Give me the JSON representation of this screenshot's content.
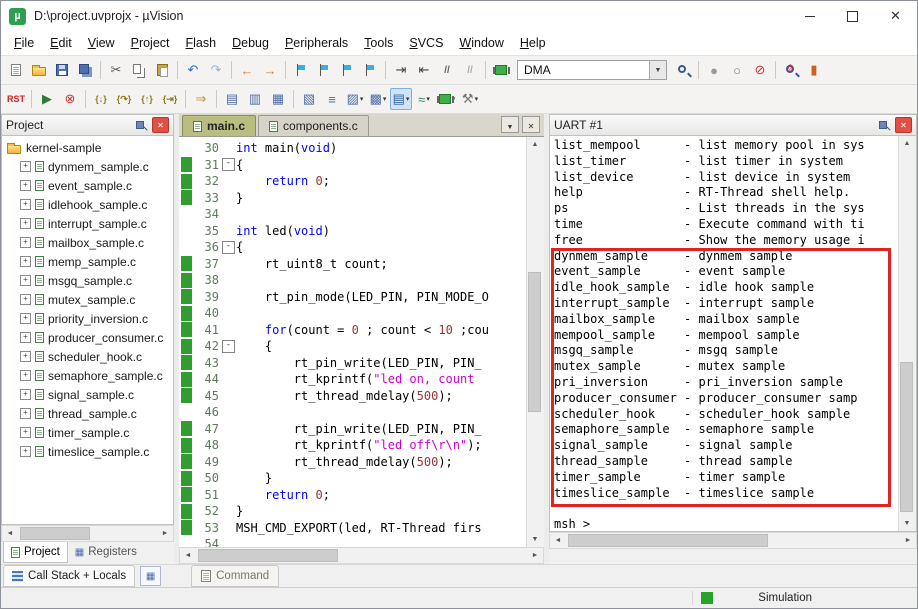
{
  "window": {
    "title": "D:\\project.uvprojx - µVision"
  },
  "menu": [
    "File",
    "Edit",
    "View",
    "Project",
    "Flash",
    "Debug",
    "Peripherals",
    "Tools",
    "SVCS",
    "Window",
    "Help"
  ],
  "toolbar1": {
    "target": "DMA",
    "items": [
      {
        "n": "new-file",
        "cls": "page"
      },
      {
        "n": "open-file",
        "cls": "folder"
      },
      {
        "n": "save",
        "cls": "floppy"
      },
      {
        "n": "save-all",
        "cls": "floppy2"
      },
      {
        "sep": true
      },
      {
        "n": "cut",
        "g": "✂",
        "c": "#555555"
      },
      {
        "n": "copy",
        "cls": "copy"
      },
      {
        "n": "paste",
        "cls": "paste"
      },
      {
        "sep": true
      },
      {
        "n": "undo",
        "g": "↶",
        "c": "#2d6cb4"
      },
      {
        "n": "redo",
        "g": "↷",
        "c": "#9ab0cc"
      },
      {
        "sep": true
      },
      {
        "n": "navigate-back",
        "g": "←",
        "c": "#e07a1f"
      },
      {
        "n": "navigate-forward",
        "g": "→",
        "c": "#e07a1f"
      },
      {
        "sep": true
      },
      {
        "n": "toggle-bookmark",
        "cls": "flag"
      },
      {
        "n": "prev-bookmark",
        "cls": "flag"
      },
      {
        "n": "next-bookmark",
        "cls": "flag"
      },
      {
        "n": "clear-bookmarks",
        "cls": "flag"
      },
      {
        "sep": true
      },
      {
        "n": "indent",
        "g": "⇥",
        "c": "#444444"
      },
      {
        "n": "outdent",
        "g": "⇤",
        "c": "#444444"
      },
      {
        "n": "comment",
        "g": "//",
        "c": "#666666"
      },
      {
        "n": "uncomment",
        "g": "//",
        "c": "#aaaaaa"
      },
      {
        "sep": true
      },
      {
        "n": "flash-download",
        "cls": "chip"
      },
      {
        "combo": true
      },
      {
        "n": "find-in-files",
        "cls": "magnifier"
      },
      {
        "sep": true
      },
      {
        "n": "insert-breakpoint",
        "g": "●",
        "c": "#9a9a9a"
      },
      {
        "n": "enable-breakpoint",
        "g": "○",
        "c": "#777777"
      },
      {
        "n": "kill-breakpoints",
        "g": "⊘",
        "c": "#cc3333"
      },
      {
        "sep": true
      },
      {
        "n": "help-search",
        "cls": "magnifier2"
      },
      {
        "n": "infocenter",
        "g": "▮",
        "c": "#d06020"
      }
    ]
  },
  "toolbar2": {
    "items": [
      {
        "n": "reset-cpu",
        "g": "RST",
        "c": "#cc2222"
      },
      {
        "sep": true
      },
      {
        "n": "run",
        "g": "▶",
        "c": "#2f7d32"
      },
      {
        "n": "stop",
        "g": "⊗",
        "c": "#cc3333"
      },
      {
        "sep": true
      },
      {
        "n": "step-into",
        "g": "{↓}",
        "c": "#8a7a1a"
      },
      {
        "n": "step-over",
        "g": "{↷}",
        "c": "#8a7a1a"
      },
      {
        "n": "step-out",
        "g": "{↑}",
        "c": "#8a7a1a"
      },
      {
        "n": "run-to-cursor",
        "g": "{⇥}",
        "c": "#8a7a1a"
      },
      {
        "sep": true
      },
      {
        "n": "show-next-statement",
        "g": "⇒",
        "c": "#d98a1f"
      },
      {
        "sep": true
      },
      {
        "n": "command-window",
        "g": "▤",
        "c": "#4a6da8"
      },
      {
        "n": "disassembly-window",
        "g": "▥",
        "c": "#4a6da8"
      },
      {
        "n": "symbol-window",
        "g": "▦",
        "c": "#4a6da8"
      },
      {
        "sep": true
      },
      {
        "n": "registers-window",
        "g": "▧",
        "c": "#4a6da8"
      },
      {
        "n": "call-stack-window",
        "g": "≡",
        "c": "#4a6da8"
      },
      {
        "n": "watch-window",
        "g": "▨",
        "c": "#4a6da8",
        "caret": true
      },
      {
        "n": "memory-window",
        "g": "▩",
        "c": "#4a6da8",
        "caret": true
      },
      {
        "n": "serial-window",
        "g": "▤",
        "c": "#2b5fa8",
        "caret": true,
        "pressed": true
      },
      {
        "n": "analysis-window",
        "g": "≈",
        "c": "#2b8a5f",
        "caret": true
      },
      {
        "n": "system-viewer",
        "cls": "chip",
        "caret": true
      },
      {
        "n": "toolbox",
        "g": "⚒",
        "c": "#777777",
        "caret": true
      }
    ]
  },
  "project": {
    "title": "Project",
    "root": "kernel-sample",
    "items": [
      "dynmem_sample.c",
      "event_sample.c",
      "idlehook_sample.c",
      "interrupt_sample.c",
      "mailbox_sample.c",
      "memp_sample.c",
      "msgq_sample.c",
      "mutex_sample.c",
      "priority_inversion.c",
      "producer_consumer.c",
      "scheduler_hook.c",
      "semaphore_sample.c",
      "signal_sample.c",
      "thread_sample.c",
      "timer_sample.c",
      "timeslice_sample.c"
    ],
    "tabs": [
      {
        "label": "Project",
        "active": true
      },
      {
        "label": "Registers",
        "active": false
      }
    ]
  },
  "editor": {
    "tabs": [
      {
        "label": "main.c"
      },
      {
        "label": "components.c"
      }
    ],
    "active_index": 0,
    "lines": [
      {
        "no": 30,
        "bar": 0,
        "seg": [
          [
            "k",
            "int"
          ],
          [
            "t",
            " main("
          ],
          [
            "k",
            "void"
          ],
          [
            "t",
            ")"
          ]
        ]
      },
      {
        "no": 31,
        "bar": 1,
        "fold": "-",
        "seg": [
          [
            "t",
            "{"
          ]
        ]
      },
      {
        "no": 32,
        "bar": 1,
        "seg": [
          [
            "t",
            "    "
          ],
          [
            "k",
            "return"
          ],
          [
            "t",
            " "
          ],
          [
            "n",
            "0"
          ],
          [
            "t",
            ";"
          ]
        ]
      },
      {
        "no": 33,
        "bar": 1,
        "seg": [
          [
            "t",
            "}"
          ]
        ]
      },
      {
        "no": 34,
        "bar": 0,
        "seg": []
      },
      {
        "no": 35,
        "bar": 0,
        "seg": [
          [
            "k",
            "int"
          ],
          [
            "t",
            " led("
          ],
          [
            "k",
            "void"
          ],
          [
            "t",
            ")"
          ]
        ]
      },
      {
        "no": 36,
        "bar": 0,
        "fold": "-",
        "seg": [
          [
            "t",
            "{"
          ]
        ]
      },
      {
        "no": 37,
        "bar": 1,
        "seg": [
          [
            "t",
            "    rt_uint8_t count;"
          ]
        ]
      },
      {
        "no": 38,
        "bar": 1,
        "seg": []
      },
      {
        "no": 39,
        "bar": 1,
        "seg": [
          [
            "t",
            "    rt_pin_mode(LED_PIN, PIN_MODE_O"
          ]
        ]
      },
      {
        "no": 40,
        "bar": 1,
        "seg": []
      },
      {
        "no": 41,
        "bar": 1,
        "seg": [
          [
            "t",
            "    "
          ],
          [
            "k",
            "for"
          ],
          [
            "t",
            "(count = "
          ],
          [
            "n",
            "0"
          ],
          [
            "t",
            " ; count < "
          ],
          [
            "n",
            "10"
          ],
          [
            "t",
            " ;cou"
          ]
        ]
      },
      {
        "no": 42,
        "bar": 1,
        "fold": "-",
        "seg": [
          [
            "t",
            "    {"
          ]
        ]
      },
      {
        "no": 43,
        "bar": 1,
        "seg": [
          [
            "t",
            "        rt_pin_write(LED_PIN, PIN_"
          ]
        ]
      },
      {
        "no": 44,
        "bar": 1,
        "seg": [
          [
            "t",
            "        rt_kprintf("
          ],
          [
            "s",
            "\"led on, count"
          ]
        ]
      },
      {
        "no": 45,
        "bar": 1,
        "seg": [
          [
            "t",
            "        rt_thread_mdelay("
          ],
          [
            "n",
            "500"
          ],
          [
            "t",
            ");"
          ]
        ]
      },
      {
        "no": 46,
        "bar": 0,
        "seg": []
      },
      {
        "no": 47,
        "bar": 1,
        "seg": [
          [
            "t",
            "        rt_pin_write(LED_PIN, PIN_"
          ]
        ]
      },
      {
        "no": 48,
        "bar": 1,
        "seg": [
          [
            "t",
            "        rt_kprintf("
          ],
          [
            "s",
            "\"led off\\r\\n\""
          ],
          [
            "t",
            ");"
          ]
        ]
      },
      {
        "no": 49,
        "bar": 1,
        "seg": [
          [
            "t",
            "        rt_thread_mdelay("
          ],
          [
            "n",
            "500"
          ],
          [
            "t",
            ");"
          ]
        ]
      },
      {
        "no": 50,
        "bar": 1,
        "seg": [
          [
            "t",
            "    }"
          ]
        ]
      },
      {
        "no": 51,
        "bar": 1,
        "seg": [
          [
            "t",
            "    "
          ],
          [
            "k",
            "return"
          ],
          [
            "t",
            " "
          ],
          [
            "n",
            "0"
          ],
          [
            "t",
            ";"
          ]
        ]
      },
      {
        "no": 52,
        "bar": 1,
        "seg": [
          [
            "t",
            "}"
          ]
        ]
      },
      {
        "no": 53,
        "bar": 1,
        "seg": [
          [
            "t",
            "MSH_CMD_EXPORT(led, RT-Thread firs"
          ]
        ]
      },
      {
        "no": 54,
        "bar": 0,
        "seg": []
      }
    ]
  },
  "uart": {
    "title": "UART #1",
    "lines": [
      "list_mempool      - list memory pool in sys",
      "list_timer        - list timer in system",
      "list_device       - list device in system",
      "help              - RT-Thread shell help.",
      "ps                - List threads in the sys",
      "time              - Execute command with ti",
      "free              - Show the memory usage i",
      "dynmem_sample     - dynmem sample",
      "event_sample      - event sample",
      "idle_hook_sample  - idle hook sample",
      "interrupt_sample  - interrupt sample",
      "mailbox_sample    - mailbox sample",
      "mempool_sample    - mempool sample",
      "msgq_sample       - msgq sample",
      "mutex_sample      - mutex sample",
      "pri_inversion     - pri_inversion sample",
      "producer_consumer - producer_consumer samp",
      "scheduler_hook    - scheduler_hook sample",
      "semaphore_sample  - semaphore sample",
      "signal_sample     - signal sample",
      "thread_sample     - thread sample",
      "timer_sample      - timer sample",
      "timeslice_sample  - timeslice sample"
    ],
    "prompt": "msh >"
  },
  "bottom": {
    "call_stack_label": "Call Stack + Locals",
    "command_label": "Command"
  },
  "status": {
    "mode": "Simulation"
  },
  "colors": {
    "keyword": "#0000ff",
    "string": "#cc00cc",
    "number": "#993333",
    "change_bar": "#2f9e2f",
    "active_tab": "#b9bd7f",
    "highlight_box": "#e32222"
  }
}
